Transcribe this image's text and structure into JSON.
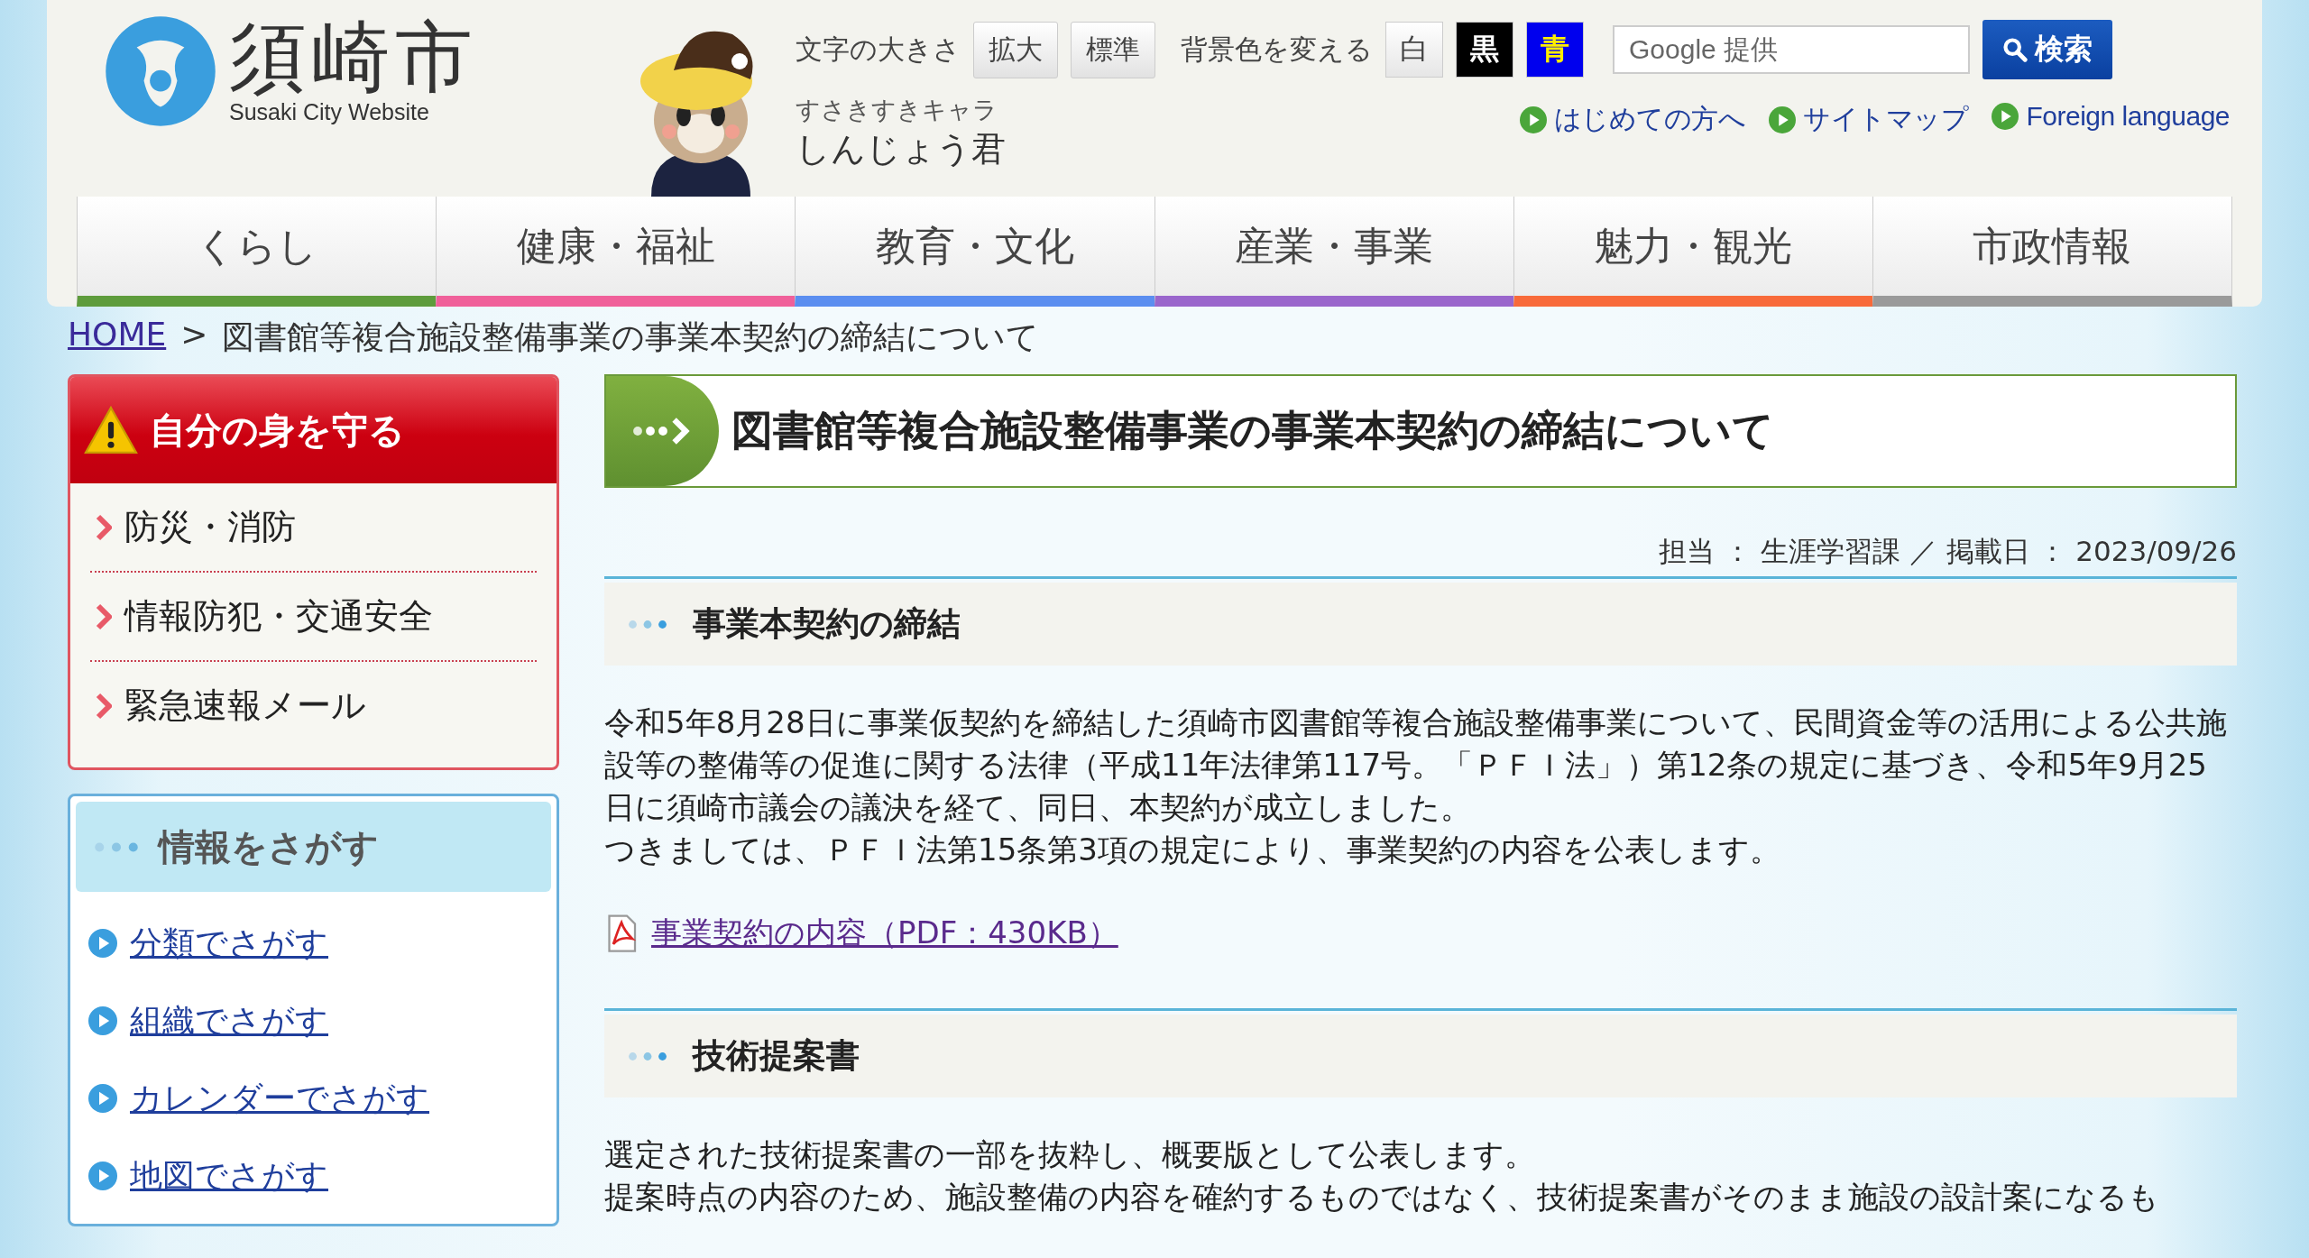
{
  "header": {
    "logo_title": "須崎市",
    "logo_subtitle": "Susaki City Website",
    "mascot_caption": "すさきすきキャラ",
    "mascot_name": "しんじょう君",
    "font_size_label": "文字の大きさ",
    "font_size_buttons": [
      "拡大",
      "標準"
    ],
    "bg_color_label": "背景色を変える",
    "bg_color_buttons": [
      {
        "label": "白",
        "kind": "white"
      },
      {
        "label": "黒",
        "kind": "black"
      },
      {
        "label": "青",
        "kind": "blue"
      }
    ],
    "search": {
      "placeholder": "Google 提供",
      "button": "検索"
    },
    "links": [
      "はじめての方へ",
      "サイトマップ",
      "Foreign language"
    ]
  },
  "nav": [
    {
      "label": "くらし",
      "color": "#5e9c3c"
    },
    {
      "label": "健康・福祉",
      "color": "#f0609a"
    },
    {
      "label": "教育・文化",
      "color": "#5b8ef0"
    },
    {
      "label": "産業・事業",
      "color": "#9a66cc"
    },
    {
      "label": "魅力・観光",
      "color": "#f86a3a"
    },
    {
      "label": "市政情報",
      "color": "#9a9a9a"
    }
  ],
  "breadcrumb": {
    "home": "HOME",
    "separator": ">",
    "current": "図書館等複合施設整備事業の事業本契約の締結について"
  },
  "sidebar": {
    "safety": {
      "title": "自分の身を守る",
      "items": [
        "防災・消防",
        "情報防犯・交通安全",
        "緊急速報メール"
      ]
    },
    "find_info": {
      "title": "情報をさがす",
      "links": [
        "分類でさがす",
        "組織でさがす",
        "カレンダーでさがす",
        "地図でさがす"
      ]
    }
  },
  "article": {
    "title": "図書館等複合施設整備事業の事業本契約の締結について",
    "meta": "担当 ： 生涯学習課 ／ 掲載日 ： 2023/09/26",
    "sections": [
      {
        "heading": "事業本契約の締結",
        "paragraphs": [
          "令和5年8月28日に事業仮契約を締結した須崎市図書館等複合施設整備事業について、民間資金等の活用による公共施設等の整備等の促進に関する法律（平成11年法律第117号。「ＰＦＩ法」）第12条の規定に基づき、令和5年9月25日に須崎市議会の議決を経て、同日、本契約が成立しました。",
          "つきましては、ＰＦＩ法第15条第3項の規定により、事業契約の内容を公表します。"
        ],
        "attachments": [
          "事業契約の内容（PDF：430KB）"
        ]
      },
      {
        "heading": "技術提案書",
        "paragraphs": [
          "選定された技術提案書の一部を抜粋し、概要版として公表します。",
          "提案時点の内容のため、施設整備の内容を確約するものではなく、技術提案書がそのまま施設の設計案になるも"
        ]
      }
    ]
  }
}
